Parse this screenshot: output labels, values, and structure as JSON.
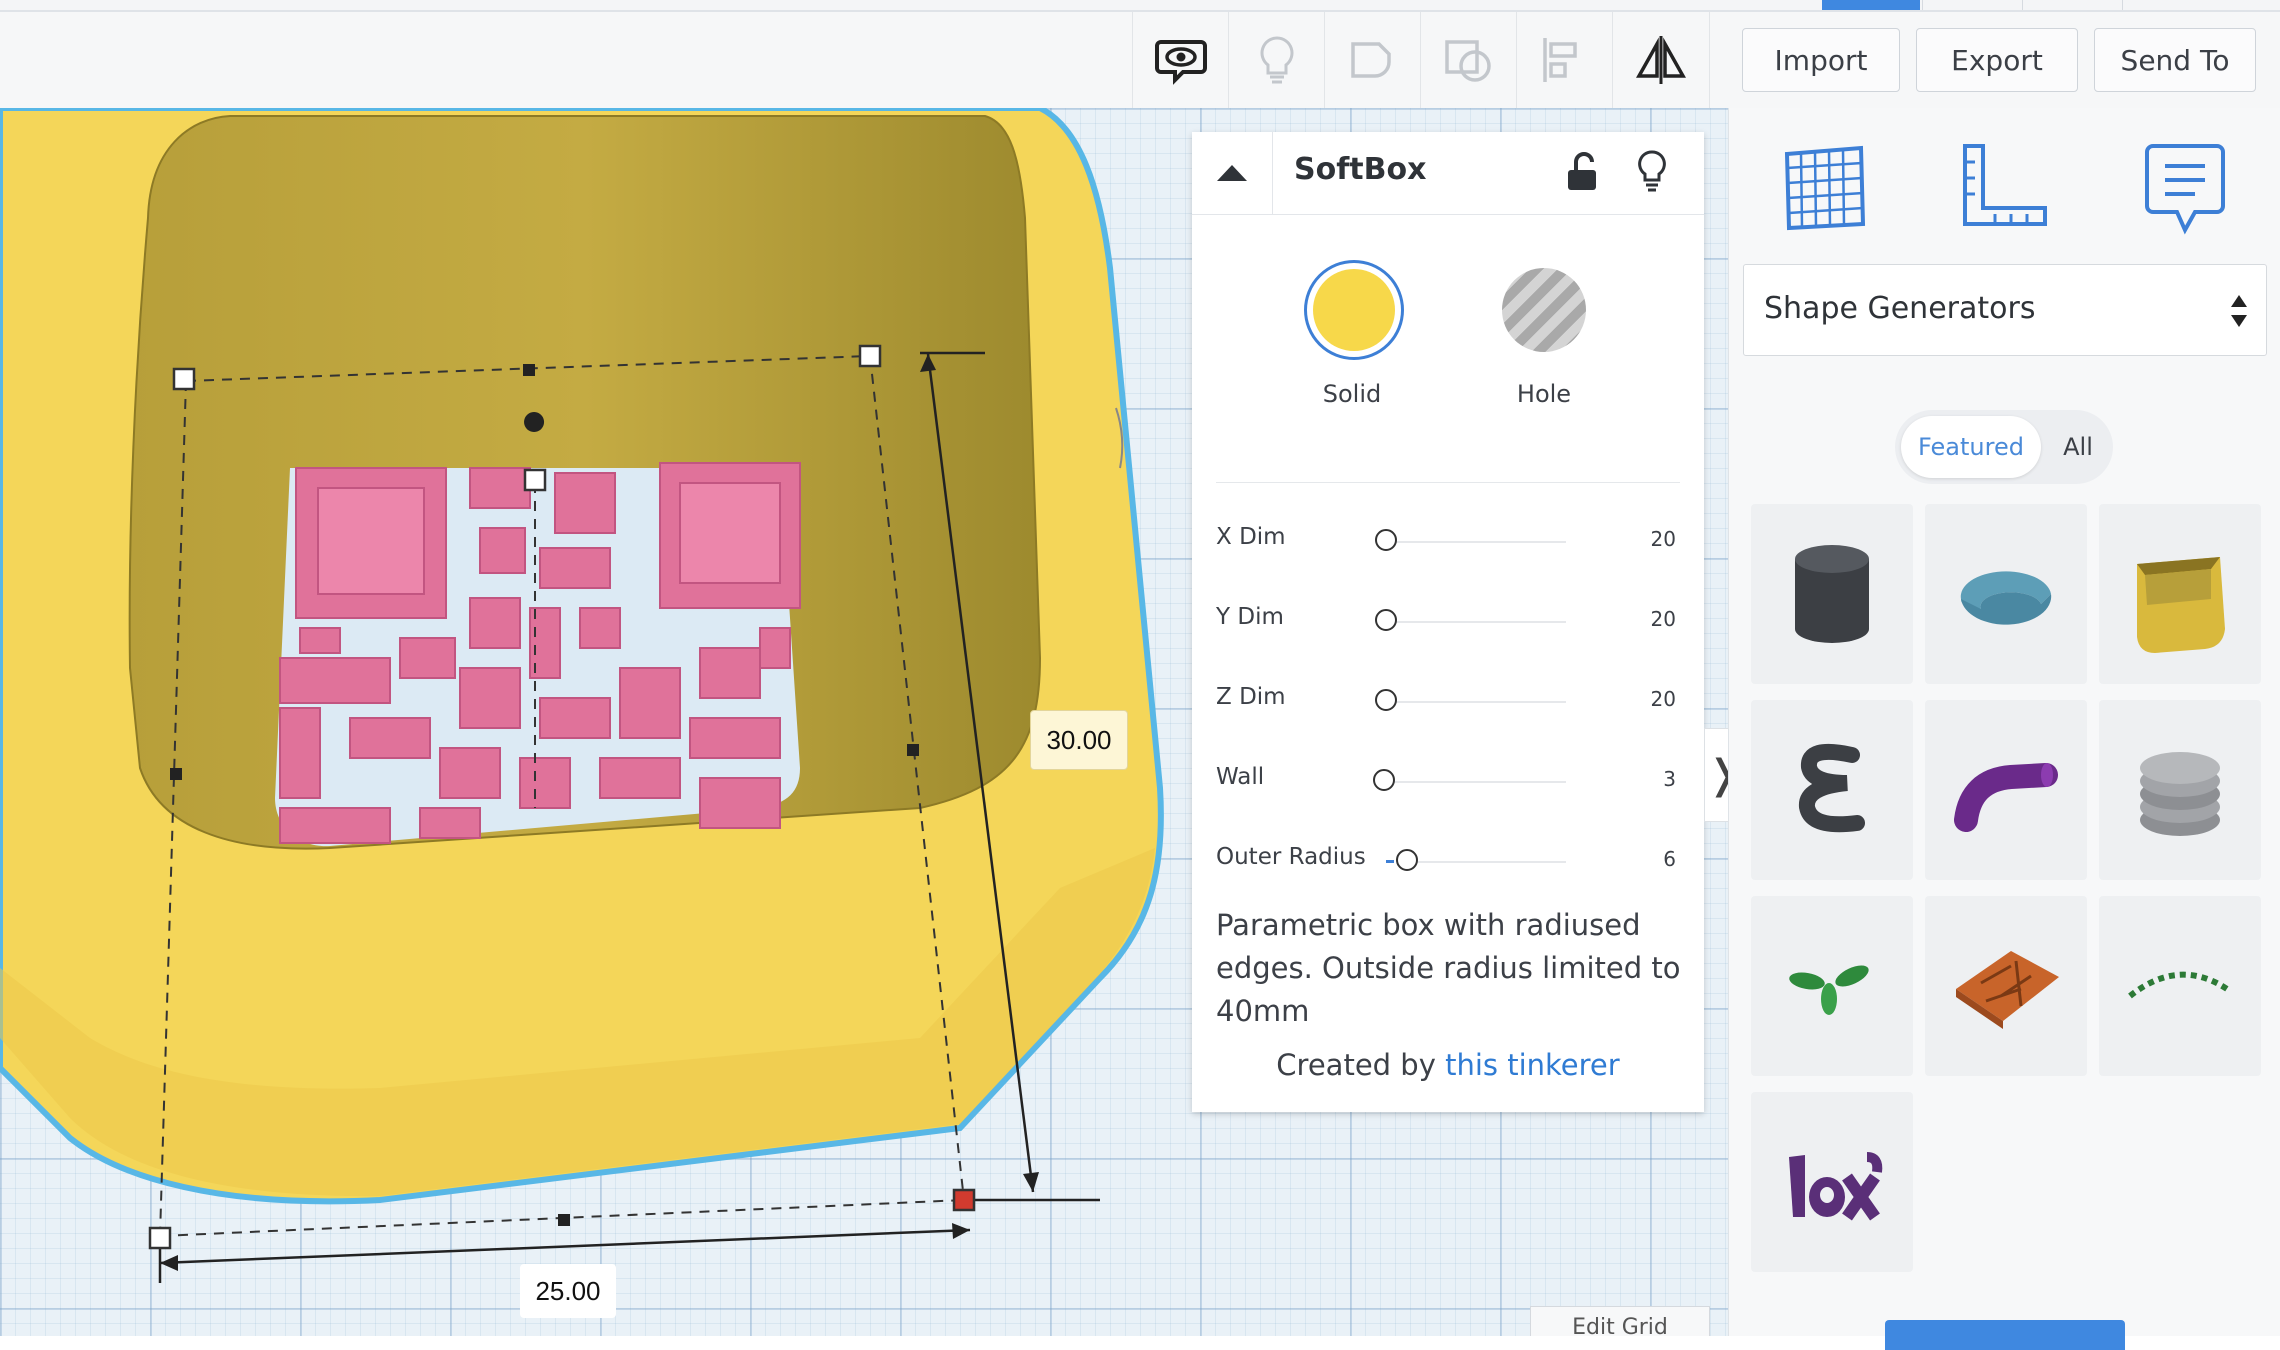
{
  "toolbar": {
    "tools": [
      "eye-comment-icon",
      "lightbulb-icon",
      "group-icon",
      "ungroup-icon",
      "align-icon",
      "mirror-icon"
    ],
    "buttons": {
      "import": "Import",
      "export": "Export",
      "send_to": "Send To"
    }
  },
  "workplane": {
    "height_label": "30.00",
    "width_label": "25.00",
    "edit_grid": "Edit Grid"
  },
  "inspector": {
    "shape_name": "SoftBox",
    "solid_label": "Solid",
    "hole_label": "Hole",
    "params": [
      {
        "label": "X Dim",
        "value": "20",
        "fraction": 0.0
      },
      {
        "label": "Y Dim",
        "value": "20",
        "fraction": 0.0
      },
      {
        "label": "Z Dim",
        "value": "20",
        "fraction": 0.0
      },
      {
        "label": "Wall",
        "value": "3",
        "fraction": 0.0
      },
      {
        "label": "Outer Radius",
        "value": "6",
        "fraction": 0.0
      }
    ],
    "description": "Parametric box with radiused edges. Outside radius limited to 40mm",
    "credit_prefix": "Created by",
    "credit_link": "this tinkerer",
    "colors": {
      "solid": "#f7d84a",
      "hole_stripes": "#a9a9a9",
      "selection": "#3d7fd6"
    }
  },
  "panel": {
    "tabs": [
      "grid-icon",
      "ruler-icon",
      "notes-icon"
    ],
    "dropdown": "Shape Generators",
    "filter": {
      "featured": "Featured",
      "all": "All"
    },
    "shapes": [
      "cylinder-shape-icon",
      "torus-shape-icon",
      "softbox-shape-icon",
      "spiral-shape-icon",
      "bent-tube-shape-icon",
      "screw-thread-shape-icon",
      "leaf-shape-icon",
      "voronoi-tile-shape-icon",
      "chain-arc-shape-icon",
      "text-shape-icon"
    ]
  }
}
